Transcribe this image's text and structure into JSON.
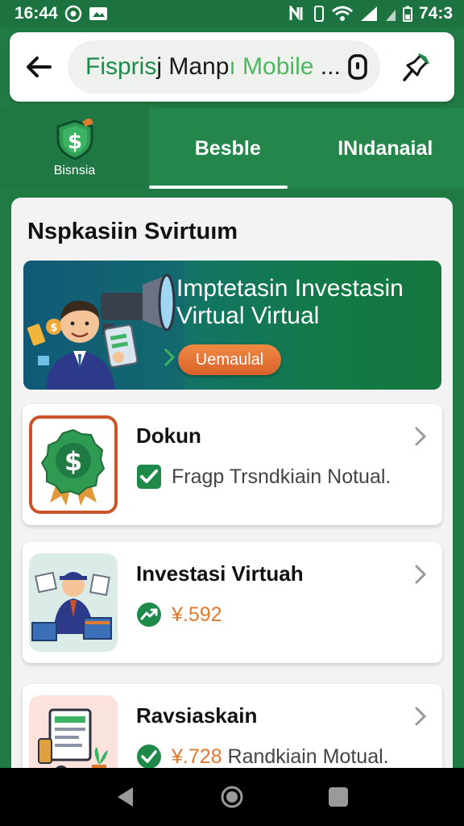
{
  "status_bar": {
    "time": "16:44",
    "battery_text": "74:3"
  },
  "app_bar": {
    "url_a": "Fispris",
    "url_b": "j Manp",
    "url_c": "ı Mobile",
    "url_d": " ..."
  },
  "tabs": {
    "brand_label": "Bisnsia",
    "tab1": "Besble",
    "tab2": "INıdanaial"
  },
  "section": {
    "title": "Nspkasiin Svirtuım"
  },
  "promo": {
    "title": "Imptetasin Investasin Virtual Virtual",
    "button": "Uemaulal"
  },
  "cards": [
    {
      "title": "Dokun",
      "subtitle": "Fragp Trsndkiain Notual."
    },
    {
      "title": "Investasi Virtuah",
      "value": "¥.592"
    },
    {
      "title": "Ravsiaskain",
      "value": "¥.728",
      "subtitle": " Randkiain Motual."
    }
  ],
  "colors": {
    "brand_green": "#1f7a43",
    "accent_orange": "#e0792b",
    "check_green": "#1e8a4a"
  },
  "icons": [
    "back-arrow-icon",
    "lock-icon",
    "pin-icon",
    "dollar-shield-icon",
    "check-icon",
    "trend-up-icon",
    "chevron-right-icon"
  ]
}
